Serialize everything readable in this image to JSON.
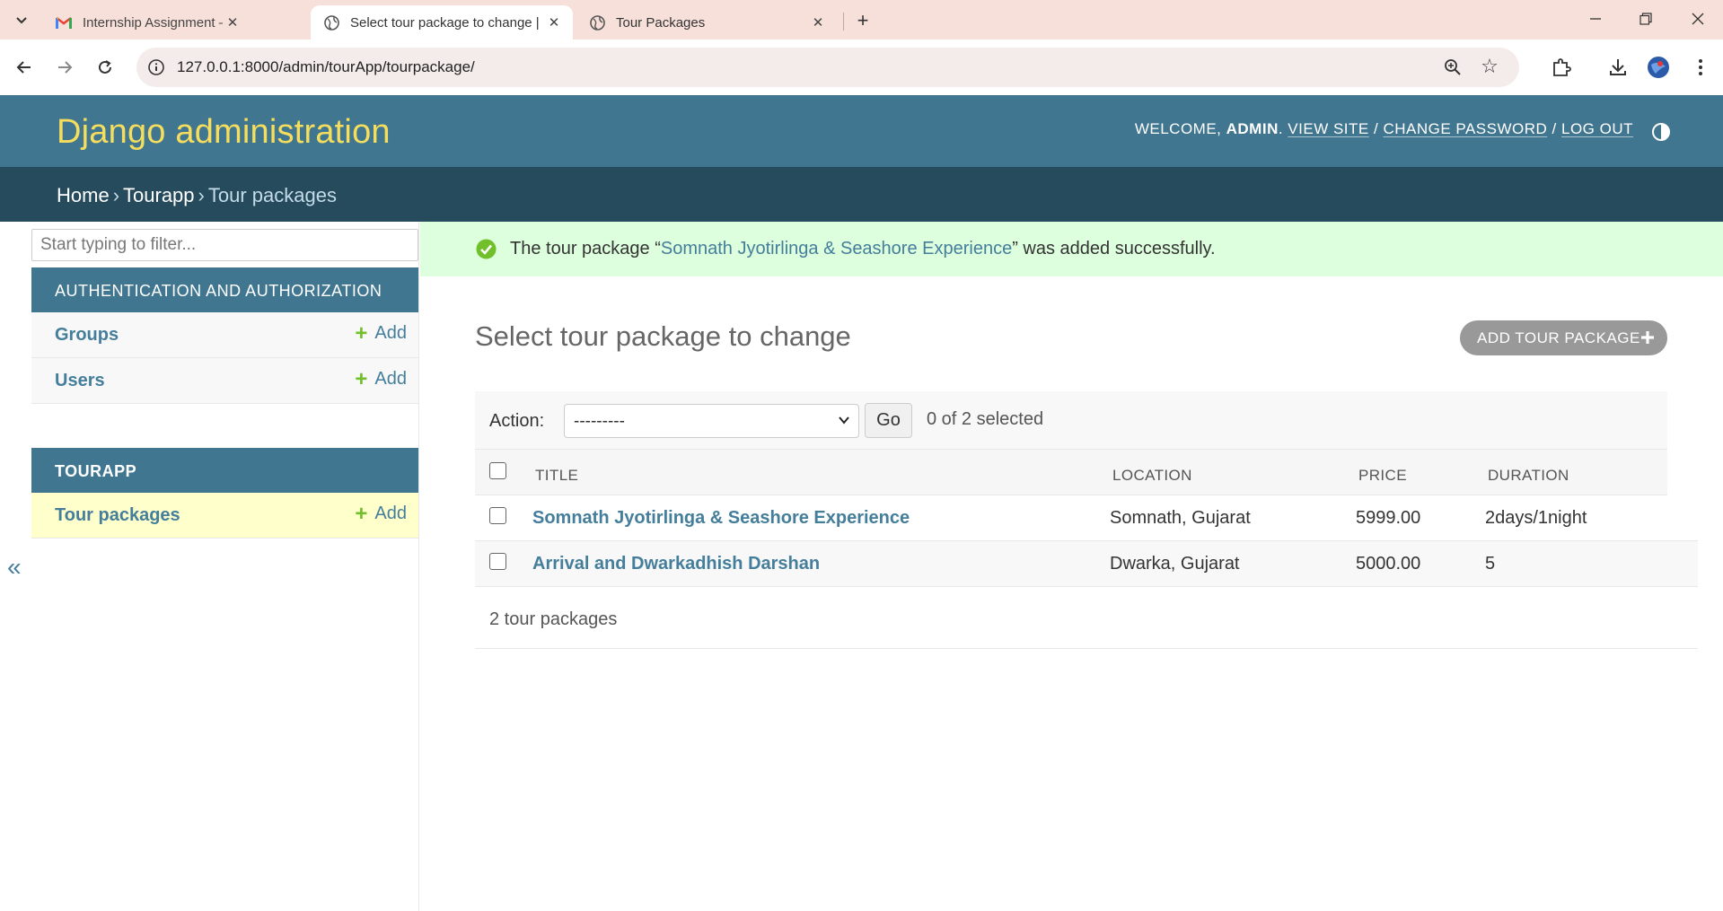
{
  "browser": {
    "tabs": [
      {
        "title": "Internship Assignment – Tour P",
        "favicon": "gmail-icon",
        "active": false
      },
      {
        "title": "Select tour package to change |",
        "favicon": "globe-icon",
        "active": true
      },
      {
        "title": "Tour Packages",
        "favicon": "globe-icon",
        "active": false
      }
    ],
    "url": "127.0.0.1:8000/admin/tourApp/tourpackage/"
  },
  "header": {
    "brand": "Django administration",
    "welcome": "Welcome,",
    "user": "admin",
    "view_site": "View site",
    "change_password": "Change password",
    "log_out": "Log out"
  },
  "breadcrumbs": {
    "home": "Home",
    "app": "Tourapp",
    "current": "Tour packages"
  },
  "sidebar": {
    "filter_placeholder": "Start typing to filter...",
    "modules": [
      {
        "caption": "Authentication and Authorization",
        "models": [
          {
            "name": "Groups",
            "add": "Add"
          },
          {
            "name": "Users",
            "add": "Add"
          }
        ]
      },
      {
        "caption": "Tourapp",
        "models": [
          {
            "name": "Tour packages",
            "add": "Add"
          }
        ]
      }
    ],
    "collapse": "«"
  },
  "messages": {
    "prefix": "The tour package “",
    "link": "Somnath Jyotirlinga & Seashore Experience",
    "suffix": "” was added successfully."
  },
  "content": {
    "title": "Select tour package to change",
    "add_button": "Add tour package",
    "action_label": "Action:",
    "action_selected": "---------",
    "go": "Go",
    "counter": "0 of 2 selected",
    "columns": [
      "Title",
      "Location",
      "Price",
      "Duration"
    ],
    "rows": [
      {
        "title": "Somnath Jyotirlinga & Seashore Experience",
        "location": "Somnath, Gujarat",
        "price": "5999.00",
        "duration": "2days/1night"
      },
      {
        "title": "Arrival and Dwarkadhish Darshan",
        "location": "Dwarka, Gujarat",
        "price": "5000.00",
        "duration": "5"
      }
    ],
    "paginator": "2 tour packages"
  },
  "colors": {
    "header_bg": "#417690",
    "breadcrumb_bg": "#264b5d",
    "brand": "#f5dd5d",
    "link": "#447e9b",
    "success_bg": "#dddddd",
    "add_green": "#70bf2b"
  }
}
